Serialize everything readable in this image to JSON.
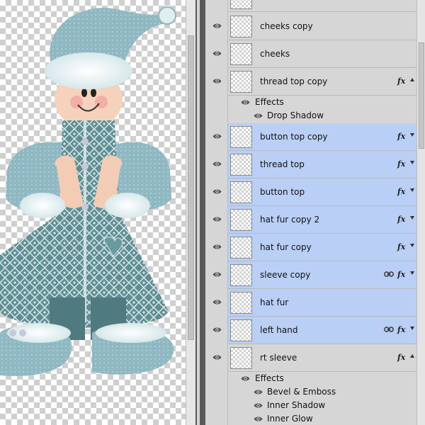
{
  "layers": [
    {
      "name": "cheeks copy",
      "selected": false,
      "fx": false,
      "link": false
    },
    {
      "name": "cheeks",
      "selected": false,
      "fx": false,
      "link": false
    },
    {
      "name": "thread top copy",
      "selected": false,
      "fx": true,
      "link": false,
      "effects": [
        "Drop Shadow"
      ]
    },
    {
      "name": "button top copy",
      "selected": true,
      "fx": true,
      "link": false
    },
    {
      "name": "thread top",
      "selected": true,
      "fx": true,
      "link": false
    },
    {
      "name": "button top",
      "selected": true,
      "fx": true,
      "link": false
    },
    {
      "name": "hat fur copy 2",
      "selected": true,
      "fx": true,
      "link": false
    },
    {
      "name": "hat fur copy",
      "selected": true,
      "fx": true,
      "link": false
    },
    {
      "name": "sleeve copy",
      "selected": true,
      "fx": true,
      "link": true
    },
    {
      "name": "hat fur",
      "selected": true,
      "fx": false,
      "link": false
    },
    {
      "name": "left  hand",
      "selected": true,
      "fx": true,
      "link": true
    },
    {
      "name": "rt sleeve",
      "selected": false,
      "fx": true,
      "link": false,
      "effects": [
        "Bevel & Emboss",
        "Inner Shadow",
        "Inner Glow"
      ]
    }
  ],
  "effects_label": "Effects",
  "fx_label": "fx",
  "colors": {
    "panel_bg": "#d6d6d6",
    "selected_bg": "#b9cff6",
    "border": "#b9b9b9",
    "text": "#111111"
  },
  "icons": {
    "visibility": "eye-icon",
    "link": "link-icon",
    "effects": "fx-icon",
    "expand": "triangle-icon"
  }
}
